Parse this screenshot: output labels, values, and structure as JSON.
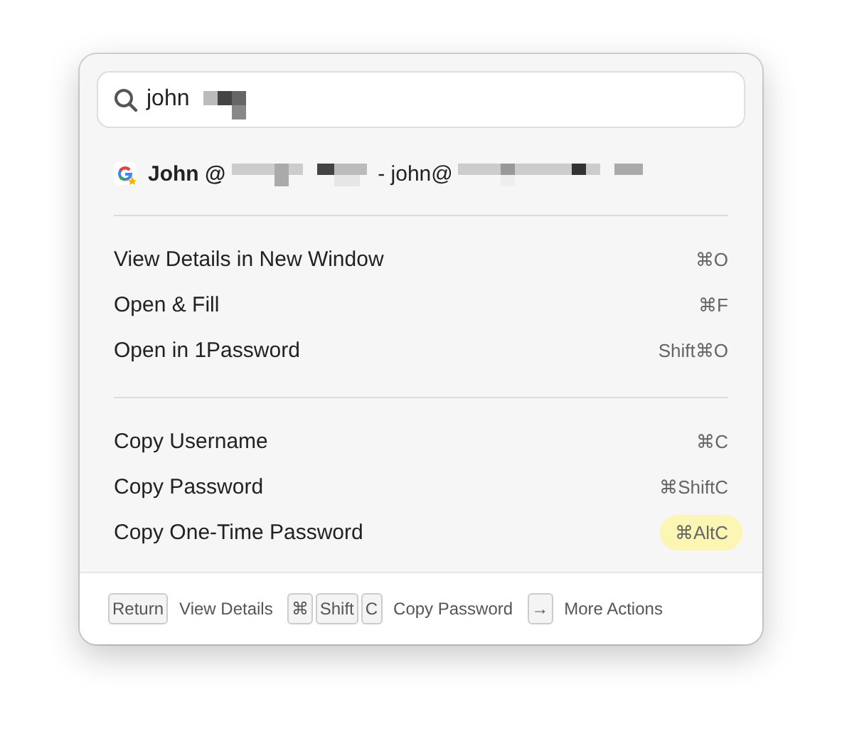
{
  "search": {
    "value": "john"
  },
  "result": {
    "name": "John @",
    "separator": "- john@"
  },
  "groups": [
    {
      "items": [
        {
          "label": "View Details in New Window",
          "shortcut": "⌘O",
          "highlighted": false
        },
        {
          "label": "Open & Fill",
          "shortcut": "⌘F",
          "highlighted": false
        },
        {
          "label": "Open in 1Password",
          "shortcut": "Shift⌘O",
          "highlighted": false
        }
      ]
    },
    {
      "items": [
        {
          "label": "Copy Username",
          "shortcut": "⌘C",
          "highlighted": false
        },
        {
          "label": "Copy Password",
          "shortcut": "⌘ShiftC",
          "highlighted": false
        },
        {
          "label": "Copy One-Time Password",
          "shortcut": "⌘AltC",
          "highlighted": true
        }
      ]
    }
  ],
  "footer": [
    {
      "keys": [
        "Return"
      ],
      "label": "View Details"
    },
    {
      "keys": [
        "⌘",
        "Shift",
        "C"
      ],
      "label": "Copy Password"
    },
    {
      "keys": [
        "→"
      ],
      "label": "More Actions"
    }
  ]
}
